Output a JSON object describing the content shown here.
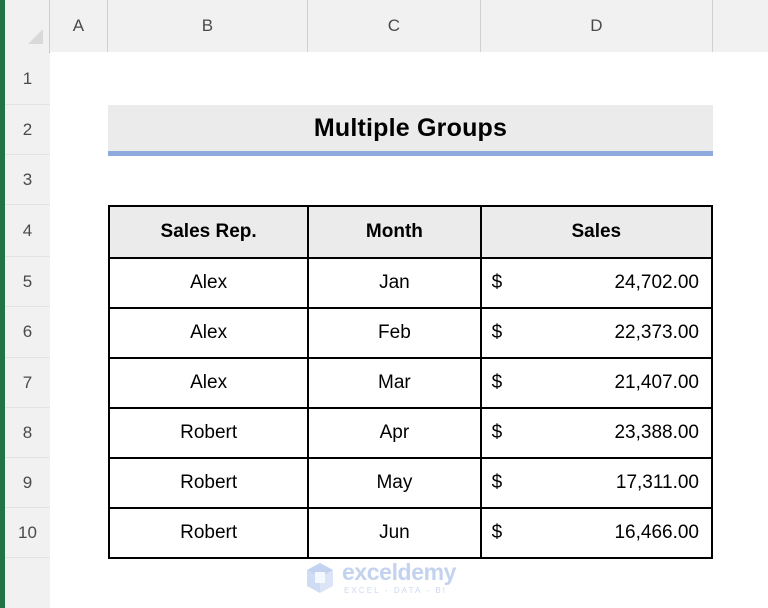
{
  "app": {
    "type": "spreadsheet",
    "accent_green": "#217346",
    "header_fill": "#f1f1f1"
  },
  "grid": {
    "column_headers": [
      "A",
      "B",
      "C",
      "D"
    ],
    "row_headers": [
      "1",
      "2",
      "3",
      "4",
      "5",
      "6",
      "7",
      "8",
      "9",
      "10"
    ]
  },
  "title_banner": {
    "text": "Multiple Groups",
    "fill_color": "#ebebeb",
    "underline_color": "#8faadc"
  },
  "table": {
    "headers": [
      "Sales Rep.",
      "Month",
      "Sales"
    ],
    "header_fill": "#ebebeb",
    "border_color": "#000000",
    "rows": [
      {
        "rep": "Alex",
        "month": "Jan",
        "currency": "$",
        "amount": "24,702.00"
      },
      {
        "rep": "Alex",
        "month": "Feb",
        "currency": "$",
        "amount": "22,373.00"
      },
      {
        "rep": "Alex",
        "month": "Mar",
        "currency": "$",
        "amount": "21,407.00"
      },
      {
        "rep": "Robert",
        "month": "Apr",
        "currency": "$",
        "amount": "23,388.00"
      },
      {
        "rep": "Robert",
        "month": "May",
        "currency": "$",
        "amount": "17,311.00"
      },
      {
        "rep": "Robert",
        "month": "Jun",
        "currency": "$",
        "amount": "16,466.00"
      }
    ]
  },
  "watermark": {
    "name": "exceldemy",
    "tagline": "EXCEL - DATA - BI",
    "color": "#c3d3ef"
  }
}
